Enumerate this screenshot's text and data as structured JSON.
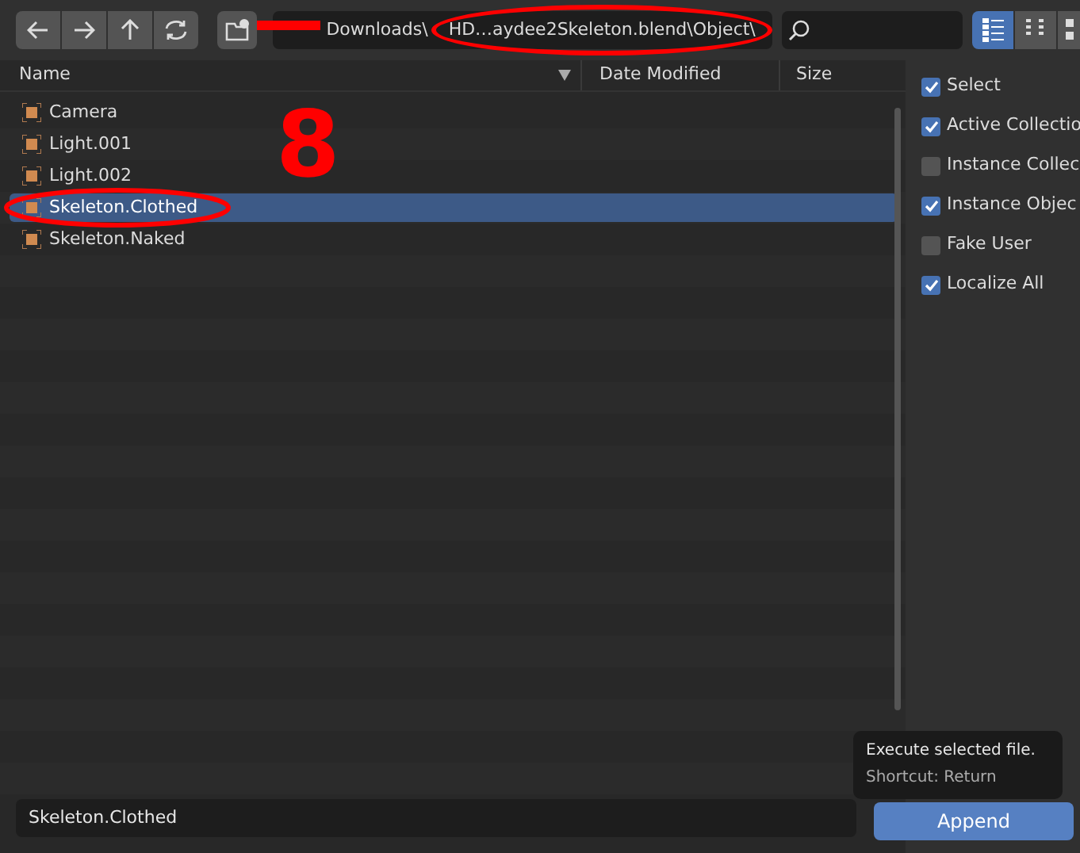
{
  "toolbar": {
    "path_parts": [
      "Downloads\\",
      "HD…aydee2Skeleton.blend\\Object\\"
    ],
    "view_modes": [
      {
        "kind": "vertical",
        "selected": true
      },
      {
        "kind": "horizontal",
        "selected": false
      },
      {
        "kind": "thumbnails",
        "selected": false
      }
    ]
  },
  "columns": [
    "Name",
    "Date Modified",
    "Size"
  ],
  "files": [
    {
      "name": "Camera",
      "selected": false
    },
    {
      "name": "Light.001",
      "selected": false
    },
    {
      "name": "Light.002",
      "selected": false
    },
    {
      "name": "Skeleton.Clothed",
      "selected": true
    },
    {
      "name": "Skeleton.Naked",
      "selected": false
    }
  ],
  "options": [
    {
      "label": "Select",
      "checked": true
    },
    {
      "label": "Active Collectio",
      "checked": true
    },
    {
      "label": "Instance Collec",
      "checked": false
    },
    {
      "label": "Instance Objec",
      "checked": true
    },
    {
      "label": "Fake User",
      "checked": false
    },
    {
      "label": "Localize All",
      "checked": true
    }
  ],
  "filename": "Skeleton.Clothed",
  "action_button": "Append",
  "tooltip": {
    "title": "Execute selected file.",
    "shortcut": "Shortcut: Return"
  },
  "annotation": {
    "number": "8"
  }
}
